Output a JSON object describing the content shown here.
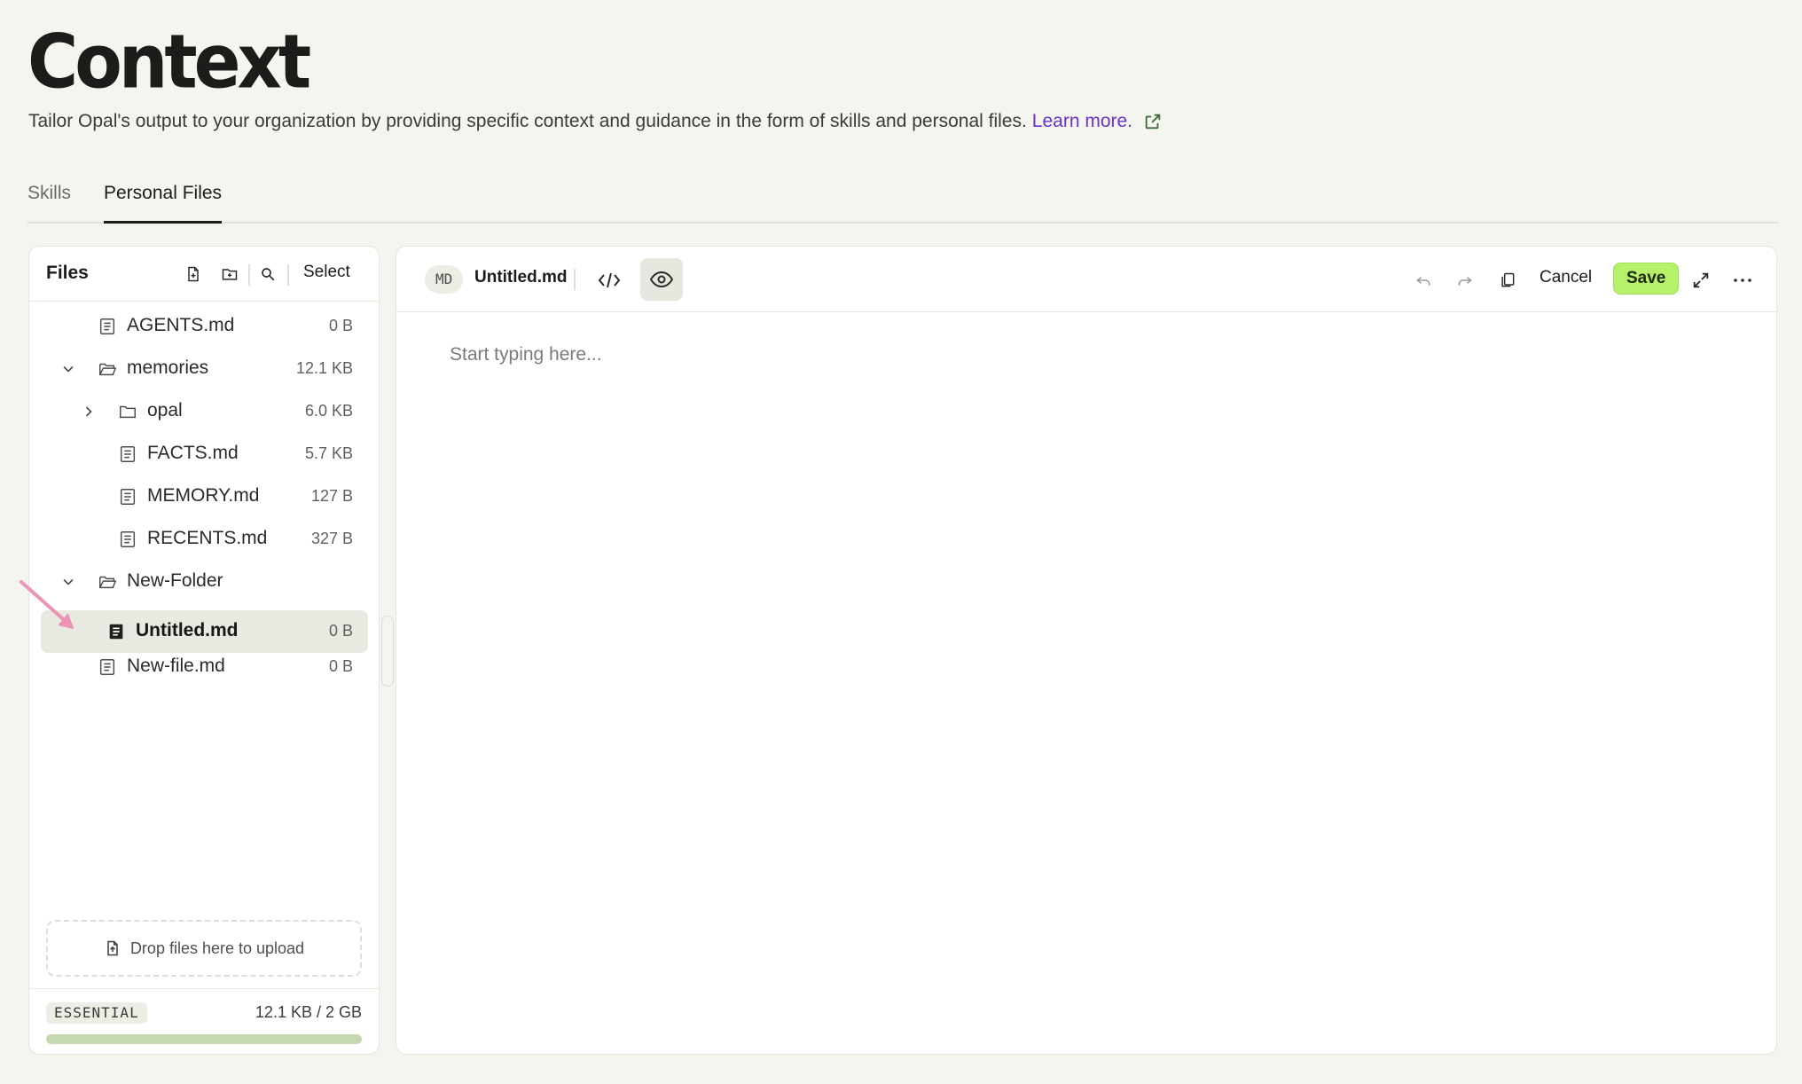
{
  "page": {
    "title": "Context",
    "subtitle": "Tailor Opal's output to your organization by providing specific context and guidance in the form of skills and personal files.",
    "learn_more": "Learn more.",
    "link_color": "#6a32c9"
  },
  "tabs": [
    {
      "label": "Skills",
      "active": false
    },
    {
      "label": "Personal Files",
      "active": true
    }
  ],
  "files_panel": {
    "title": "Files",
    "select_label": "Select",
    "header_icons": [
      "new-file-icon",
      "new-folder-icon",
      "search-icon"
    ],
    "tree": [
      {
        "name": "AGENTS.md",
        "size": "0 B",
        "type": "file"
      },
      {
        "name": "memories",
        "size": "12.1 KB",
        "type": "folder",
        "expanded": true
      },
      {
        "name": "opal",
        "size": "6.0 KB",
        "type": "folder",
        "expanded": false
      },
      {
        "name": "FACTS.md",
        "size": "5.7 KB",
        "type": "file"
      },
      {
        "name": "MEMORY.md",
        "size": "127 B",
        "type": "file"
      },
      {
        "name": "RECENTS.md",
        "size": "327 B",
        "type": "file"
      },
      {
        "name": "New-Folder",
        "size": "",
        "type": "folder",
        "expanded": true
      },
      {
        "name": "Untitled.md",
        "size": "0 B",
        "type": "file",
        "selected": true
      },
      {
        "name": "New-file.md",
        "size": "0 B",
        "type": "file"
      }
    ],
    "dropzone_label": "Drop files here to upload",
    "plan_badge": "ESSENTIAL",
    "usage": "12.1 KB / 2 GB",
    "usage_fraction": 6e-06
  },
  "editor": {
    "format_badge": "MD",
    "file_name": "Untitled.md",
    "placeholder": "Start typing here...",
    "cancel_label": "Cancel",
    "save_label": "Save",
    "save_color": "#b7f16a",
    "toolbar_icons": [
      "code-view-icon",
      "preview-eye-icon",
      "undo-icon",
      "redo-icon",
      "copy-icon",
      "expand-icon",
      "more-icon"
    ]
  }
}
